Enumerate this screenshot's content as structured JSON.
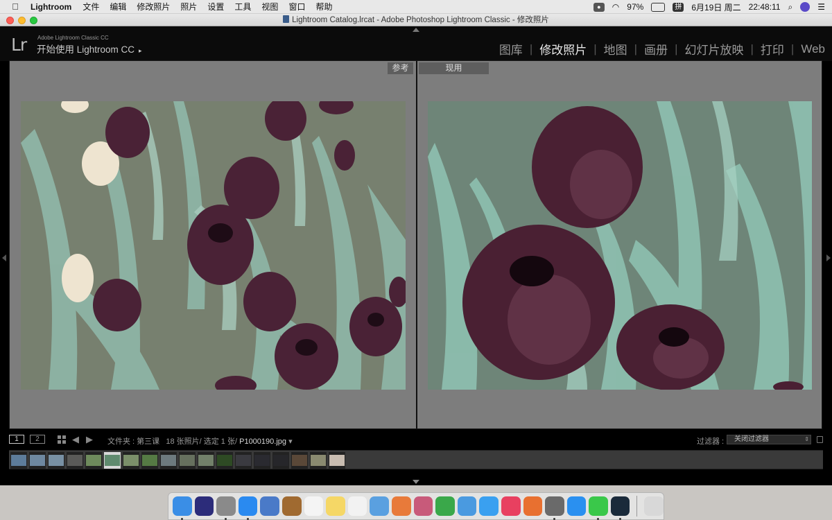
{
  "menubar": {
    "app_name": "Lightroom",
    "items": [
      "文件",
      "编辑",
      "修改照片",
      "照片",
      "设置",
      "工具",
      "视图",
      "窗口",
      "帮助"
    ],
    "battery": "97%",
    "input_method": "拼",
    "date": "6月19日 周二",
    "time": "22:48:11"
  },
  "window": {
    "title": "Lightroom Catalog.lrcat - Adobe Photoshop Lightroom Classic - 修改照片"
  },
  "header": {
    "logo": "Lr",
    "subtitle_small": "Adobe Lightroom Classic CC",
    "subtitle": "开始使用 Lightroom CC",
    "subtitle_caret": "▸",
    "modules": [
      {
        "label": "图库",
        "active": false
      },
      {
        "label": "修改照片",
        "active": true
      },
      {
        "label": "地图",
        "active": false
      },
      {
        "label": "画册",
        "active": false
      },
      {
        "label": "幻灯片放映",
        "active": false
      },
      {
        "label": "打印",
        "active": false
      },
      {
        "label": "Web",
        "active": false
      }
    ],
    "separator": "|"
  },
  "compare": {
    "reference_label": "参考",
    "current_label": "现用"
  },
  "filmstrip_bar": {
    "monitor1": "1",
    "monitor2": "2",
    "prev_arrow": "◀",
    "next_arrow": "▶",
    "folder": "文件夹 : 第三课",
    "counts": "18 张照片/ 选定 1 张/",
    "filename": "P1000190.jpg",
    "filename_caret": "▾",
    "filter_label": "过滤器 :",
    "filter_value": "关闭过滤器",
    "filter_updown": "⇕"
  },
  "filmstrip": {
    "thumb_colors": [
      "#5d7c9a",
      "#6e88a0",
      "#7890a3",
      "#5a5a58",
      "#6e8a5c",
      "#5f8a6e",
      "#7b8f6a",
      "#557a44",
      "#6d7a7e",
      "#66705e",
      "#72806a",
      "#2e4a24",
      "#3a3a40",
      "#2a2a30",
      "#26262a",
      "#5a4838",
      "#8a8a70",
      "#c8bcb0"
    ],
    "selected_index": 5
  },
  "dock": {
    "icon_colors": [
      "#3a8ee6",
      "#2c2c7a",
      "#8a8a8a",
      "#2a8af0",
      "#4a7ac8",
      "#a06a30",
      "#f4f4f4",
      "#f5d766",
      "#f2f2f2",
      "#5aa0e0",
      "#e87a3a",
      "#c85a7a",
      "#3aa84a",
      "#4a9ae0",
      "#3aa0f0",
      "#e84060",
      "#e87030",
      "#6a6a6a",
      "#2a90f0",
      "#3ac84a",
      "#1a2a3a"
    ],
    "trash_color": "#d8d8d8",
    "running": [
      0,
      2,
      3,
      17,
      19,
      20
    ]
  }
}
